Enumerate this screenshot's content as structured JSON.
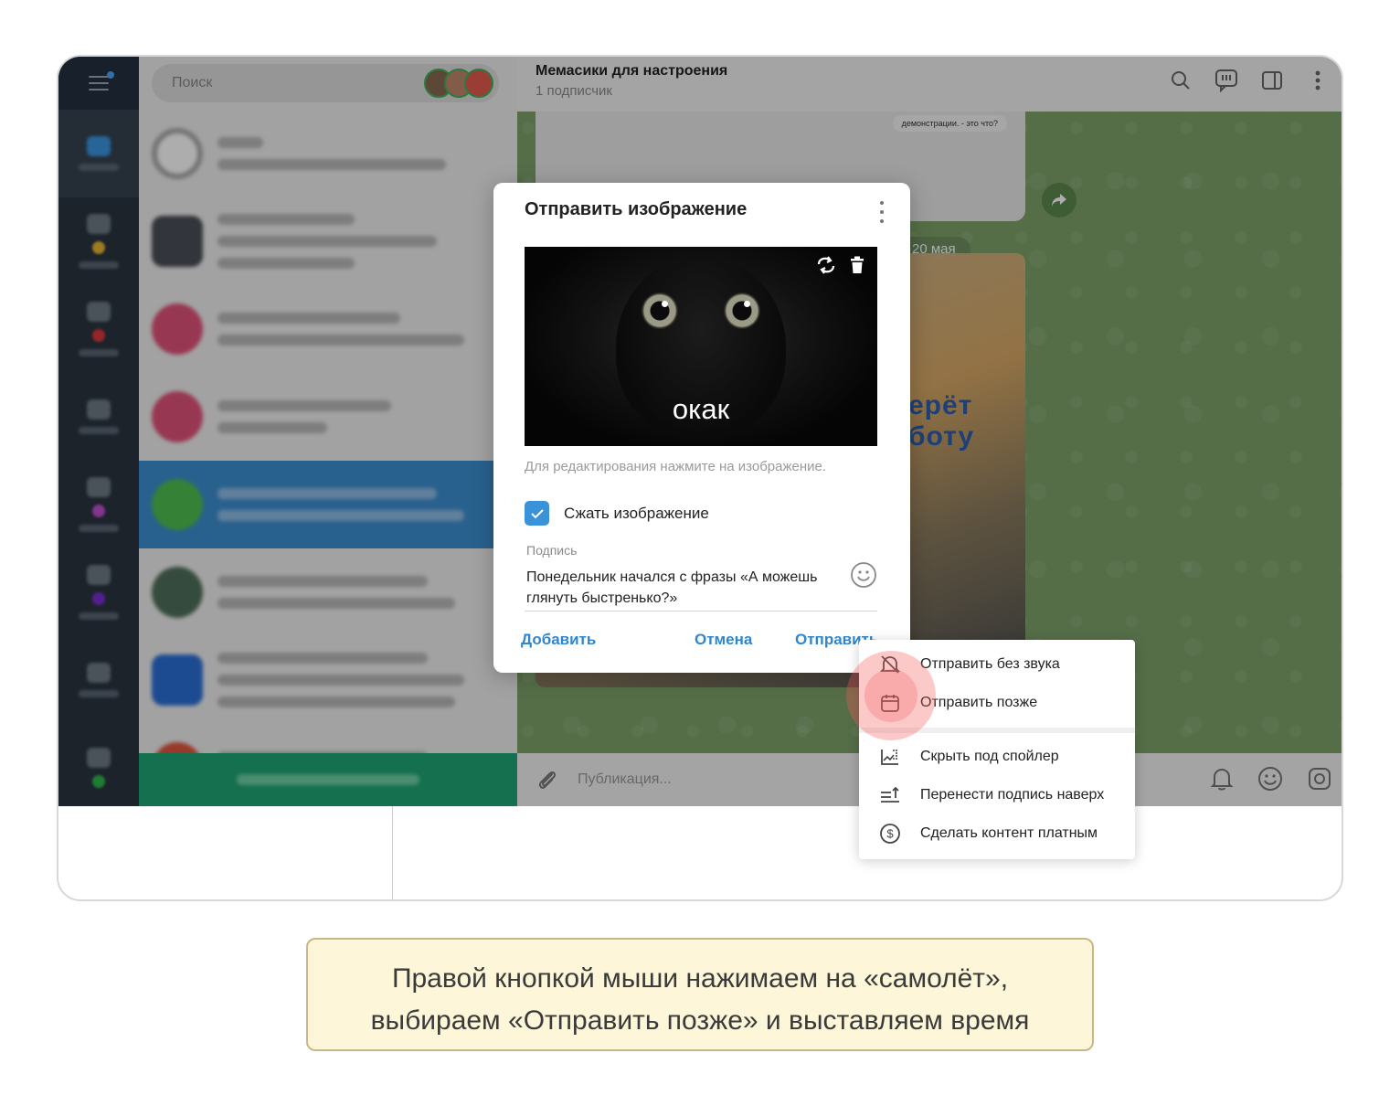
{
  "search": {
    "placeholder": "Поиск"
  },
  "chat_header": {
    "title": "Мемасики для настроения",
    "subtitle": "1 подписчик"
  },
  "chat": {
    "quote_text": "демонстрации. - это что?",
    "date_pill": "20 мая",
    "meme_text": "ерёт\nботу"
  },
  "composer": {
    "placeholder": "Публикация..."
  },
  "dialog": {
    "title": "Отправить изображение",
    "image_caption": "окак",
    "hint": "Для редактирования нажмите на изображение.",
    "compress_label": "Сжать изображение",
    "compress_checked": true,
    "caption_label": "Подпись",
    "caption_value": "Понедельник начался с фразы «А можешь глянуть быстренько?»",
    "add_label": "Добавить",
    "cancel_label": "Отмена",
    "send_label": "Отправить"
  },
  "context_menu": {
    "items": [
      {
        "label": "Отправить без звука",
        "icon": "muted-bell-icon"
      },
      {
        "label": "Отправить позже",
        "icon": "calendar-icon"
      },
      {
        "label": "Скрыть под спойлер",
        "icon": "spoiler-icon"
      },
      {
        "label": "Перенести подпись наверх",
        "icon": "caption-up-icon"
      },
      {
        "label": "Сделать контент платным",
        "icon": "paid-content-icon"
      }
    ],
    "highlighted_index": 1
  },
  "instruction": {
    "line1": "Правой кнопкой мыши нажимаем на «самолёт»,",
    "line2": "выбираем «Отправить позже» и выставляем время"
  },
  "colors": {
    "accent": "#2f86cf",
    "checkbox": "#3a92d8",
    "active_chat": "#3d8fd2",
    "update_bar": "#1ea574",
    "chat_bg": "#7ea36b",
    "note_bg": "#fdf6d8",
    "click_highlight": "#f05a5a"
  }
}
